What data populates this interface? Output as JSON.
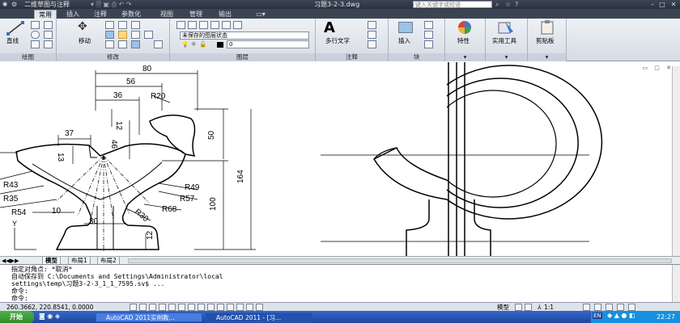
{
  "titlebar": {
    "workspace": "二维草图与注释",
    "filename": "习题3-2-3.dwg",
    "search_placeholder": "键入关键字或短语"
  },
  "tabs": [
    "常用",
    "插入",
    "注释",
    "参数化",
    "视图",
    "管理",
    "输出"
  ],
  "ribbon": {
    "line_label": "直线",
    "move_label": "移动",
    "layer_state": "未保存的图层状态",
    "layer_current": "0",
    "mtext_label": "多行文字",
    "insert_label": "插入",
    "properties_label": "特性",
    "utilities_label": "实用工具",
    "clipboard_label": "剪贴板",
    "panels": {
      "draw": "绘图",
      "modify": "修改",
      "layers": "图层",
      "annotation": "注释",
      "block": "块"
    }
  },
  "drawing": {
    "dims": {
      "d80": "80",
      "d56": "56",
      "d36": "36",
      "r20": "R20",
      "d12a": "12",
      "d37": "37",
      "d46": "46",
      "d50": "50",
      "d13": "13",
      "d164": "164",
      "d100": "100",
      "r43": "R43",
      "r35": "R35",
      "r54": "R54",
      "d10": "10",
      "d30": "30",
      "r30": "R30",
      "r49": "R49",
      "r57": "R57",
      "r68": "R68",
      "d12b": "12"
    },
    "ucs_y": "Y"
  },
  "layout_tabs": [
    "模型",
    "布局1",
    "布局2"
  ],
  "command": {
    "lines": [
      "指定对角点: *取消*",
      "自动保存到 C:\\Documents and Settings\\Administrator\\local",
      "settings\\temp\\习题3-2-3_1_1_7595.sv$ ...",
      "命令:",
      "命令:"
    ]
  },
  "status": {
    "coords": "260.3662, 220.8541, 0.0000",
    "model_label": "模型",
    "scale": "1:1"
  },
  "taskbar": {
    "start": "开始",
    "tasks": [
      "AutoCAD 2011实例教...",
      "AutoCAD 2011 - [习..."
    ],
    "lang": "EN",
    "clock": "22:27"
  },
  "colors": {
    "titlebar": "#2f3642",
    "ribbon": "#e3e8ee",
    "taskbar": "#2557b8",
    "start": "#3a9a36"
  }
}
